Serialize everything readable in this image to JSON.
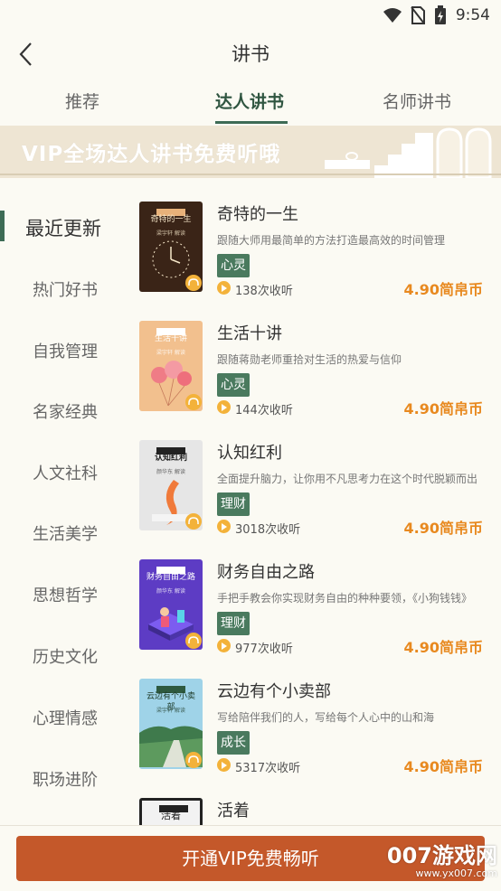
{
  "status": {
    "time": "9:54"
  },
  "header": {
    "title": "讲书"
  },
  "tabs": [
    {
      "label": "推荐",
      "active": false
    },
    {
      "label": "达人讲书",
      "active": true
    },
    {
      "label": "名师讲书",
      "active": false
    }
  ],
  "banner": {
    "text": "VIP全场达人讲书免费听哦"
  },
  "sidebar": {
    "items": [
      {
        "label": "最近更新",
        "active": true
      },
      {
        "label": "热门好书"
      },
      {
        "label": "自我管理"
      },
      {
        "label": "名家经典"
      },
      {
        "label": "人文社科"
      },
      {
        "label": "生活美学"
      },
      {
        "label": "思想哲学"
      },
      {
        "label": "历史文化"
      },
      {
        "label": "心理情感"
      },
      {
        "label": "职场进阶"
      }
    ]
  },
  "books": [
    {
      "title": "奇特的一生",
      "desc": "跟随大师用最简单的方法打造最高效的时间管理",
      "tag": "心灵",
      "plays": "138次收听",
      "price": "4.90简帛币",
      "cover_title": "奇特的一生",
      "cover_sub": "梁宇轩 解读"
    },
    {
      "title": "生活十讲",
      "desc": "跟随蒋勋老师重拾对生活的热爱与信仰",
      "tag": "心灵",
      "plays": "144次收听",
      "price": "4.90简帛币",
      "cover_title": "生活十讲",
      "cover_sub": "梁宇轩 解读"
    },
    {
      "title": "认知红利",
      "desc": "全面提升脑力，让你用不凡思考力在这个时代脱颖而出",
      "tag": "理财",
      "plays": "3018次收听",
      "price": "4.90简帛币",
      "cover_title": "认知红利",
      "cover_sub": "颜华东 解读"
    },
    {
      "title": "财务自由之路",
      "desc": "手把手教会你实现财务自由的种种要领，《小狗钱钱》",
      "tag": "理财",
      "plays": "977次收听",
      "price": "4.90简帛币",
      "cover_title": "财务自由之路",
      "cover_sub": "颜华东 解读"
    },
    {
      "title": "云边有个小卖部",
      "desc": "写给陪伴我们的人，写给每个人心中的山和海",
      "tag": "成长",
      "plays": "5317次收听",
      "price": "4.90简帛币",
      "cover_title": "云边有个小卖部",
      "cover_sub": "梁宇轩 解读"
    },
    {
      "title": "活着",
      "cover_title": "活着"
    }
  ],
  "bottom": {
    "vip_button": "开通VIP免费畅听"
  },
  "watermark": {
    "main": "007游戏网",
    "url": "www.yx007.com"
  },
  "colors": {
    "accent": "#3d6b55",
    "price": "#e8891f",
    "vip_button": "#c4582a",
    "tag_bg": "#4a7a5e"
  }
}
